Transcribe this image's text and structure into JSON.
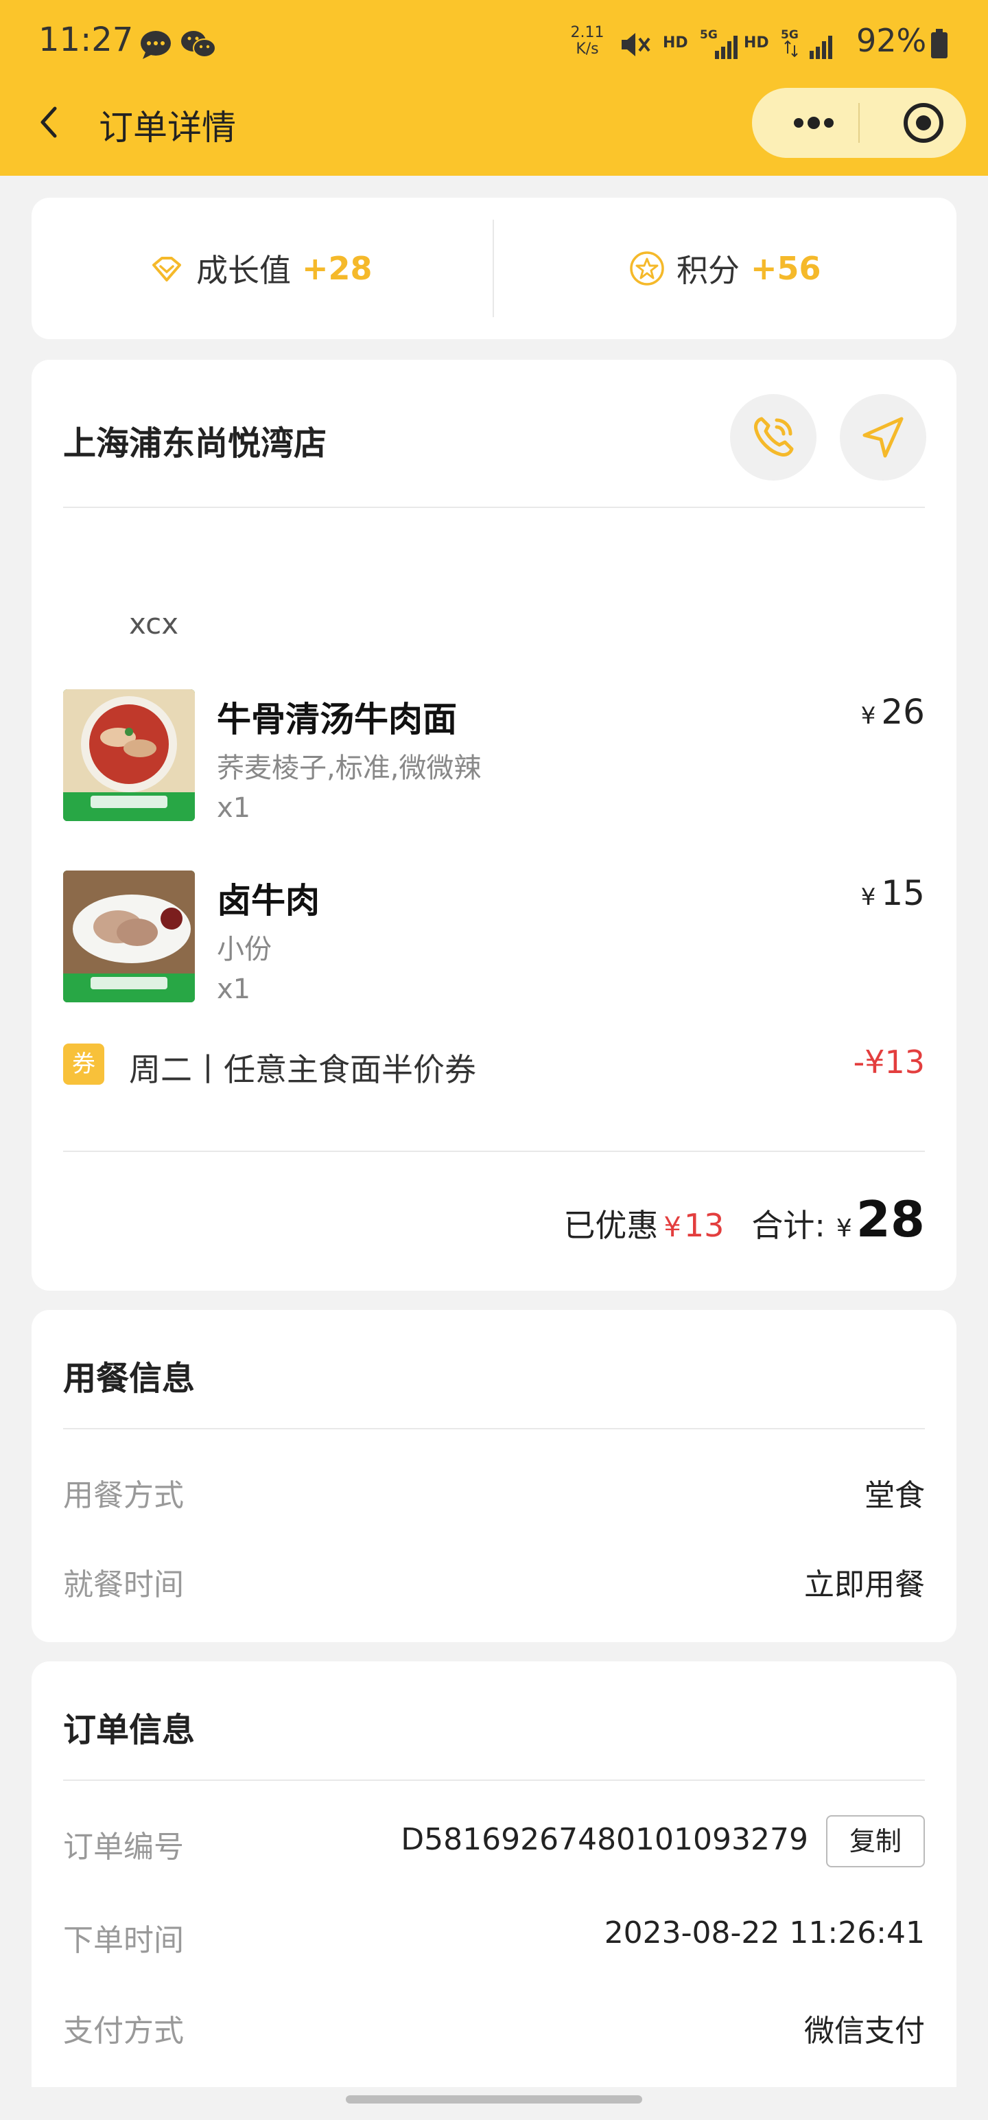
{
  "status_bar": {
    "time": "11:27",
    "net_speed_value": "2.11",
    "net_speed_unit": "K/s",
    "hd_1": "HD",
    "hd_2": "HD",
    "battery": "92%"
  },
  "nav": {
    "title": "订单详情"
  },
  "rewards": {
    "growth_label": "成长值",
    "growth_value": "+28",
    "points_label": "积分",
    "points_value": "+56"
  },
  "store": {
    "name": "上海浦东尚悦湾店",
    "note": "xcx"
  },
  "items": [
    {
      "name": "牛骨清汤牛肉面",
      "spec": "荞麦棱子,标准,微微辣",
      "qty": "x1",
      "currency": "¥",
      "price": "26"
    },
    {
      "name": "卤牛肉",
      "spec": "小份",
      "qty": "x1",
      "currency": "¥",
      "price": "15"
    }
  ],
  "coupon": {
    "badge": "券",
    "name": "周二丨任意主食面半价券",
    "amount": "-¥13"
  },
  "summary": {
    "discount_label": "已优惠",
    "discount_currency": "¥",
    "discount_amount": "13",
    "total_label": "合计:",
    "total_currency": "¥",
    "total_amount": "28"
  },
  "dining": {
    "title": "用餐信息",
    "rows": [
      {
        "label": "用餐方式",
        "value": "堂食"
      },
      {
        "label": "就餐时间",
        "value": "立即用餐"
      }
    ]
  },
  "order_info": {
    "title": "订单信息",
    "order_no_label": "订单编号",
    "order_no": "D58169267480101093279",
    "copy_label": "复制",
    "time_label": "下单时间",
    "time": "2023-08-22 11:26:41",
    "pay_label": "支付方式",
    "pay": "微信支付"
  },
  "colors": {
    "brand_yellow": "#FBC52B",
    "accent_yellow": "#F5B92A",
    "price_red": "#E33E3E"
  },
  "icons": [
    "back-arrow-icon",
    "more-dots-icon",
    "close-target-icon",
    "diamond-icon",
    "star-badge-icon",
    "phone-icon",
    "navigation-arrow-icon"
  ]
}
